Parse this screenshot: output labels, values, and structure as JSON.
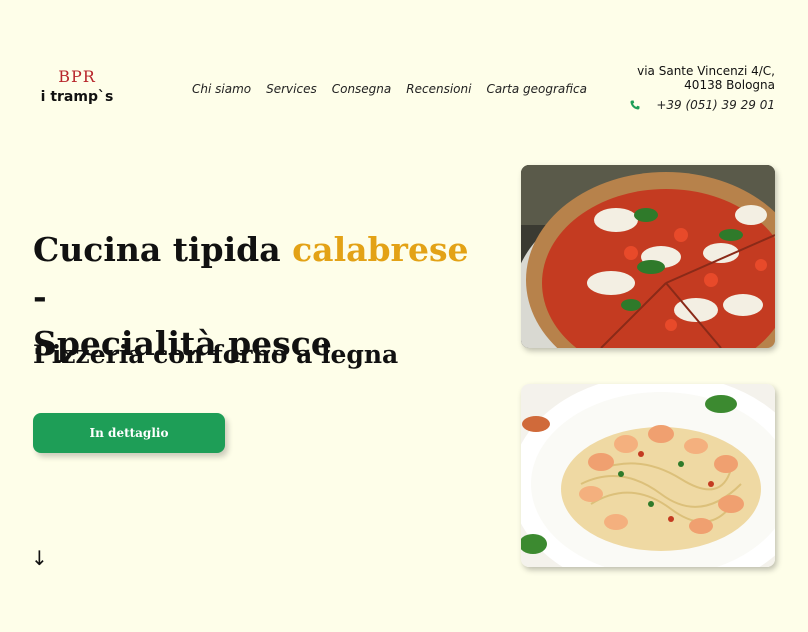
{
  "logo": {
    "top": "BPR",
    "bottom": "i tramp`s"
  },
  "nav": {
    "items": [
      "Chi siamo",
      "Services",
      "Consegna",
      "Recensioni",
      "Carta geografica"
    ]
  },
  "contact": {
    "address_line1": "via Sante Vincenzi 4/C,",
    "address_line2": "40138 Bologna",
    "phone": "+39 (051) 39 29 01"
  },
  "hero": {
    "title_part1": "Cucina tipida ",
    "title_accent": "calabrese",
    "title_part2": " -",
    "title_line2": "Specialità pesce",
    "subtitle": "Pizzeria con forno a legna",
    "cta_label": "In dettaglio",
    "scroll_icon": "arrow-down-icon"
  },
  "images": {
    "pizza_alt": "Pizza",
    "pasta_alt": "Spaghetti con gamberi"
  },
  "colors": {
    "background": "#fefee9",
    "accent": "#e3a216",
    "brand_red": "#b8262b",
    "cta_green": "#1e9e57"
  }
}
